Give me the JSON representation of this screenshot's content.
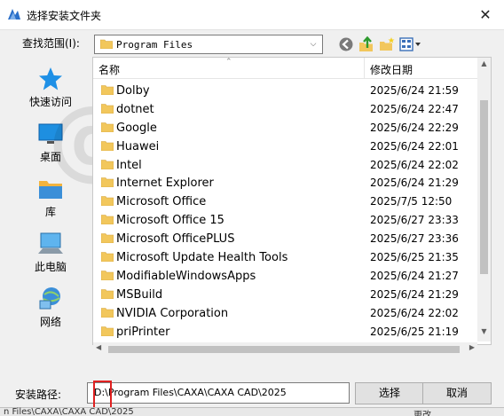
{
  "dialog": {
    "title": "选择安装文件夹",
    "close_glyph": "✕"
  },
  "look_in": {
    "label": "查找范围(I):",
    "value": "Program Files"
  },
  "places": [
    {
      "label": "快速访问",
      "icon": "star-icon"
    },
    {
      "label": "桌面",
      "icon": "desktop-icon"
    },
    {
      "label": "库",
      "icon": "library-icon"
    },
    {
      "label": "此电脑",
      "icon": "computer-icon"
    },
    {
      "label": "网络",
      "icon": "network-icon"
    }
  ],
  "columns": {
    "name": "名称",
    "date": "修改日期"
  },
  "files": [
    {
      "name": "Dolby",
      "date": "2025/6/24 21:59"
    },
    {
      "name": "dotnet",
      "date": "2025/6/24 22:47"
    },
    {
      "name": "Google",
      "date": "2025/6/24 22:29"
    },
    {
      "name": "Huawei",
      "date": "2025/6/24 22:01"
    },
    {
      "name": "Intel",
      "date": "2025/6/24 22:02"
    },
    {
      "name": "Internet Explorer",
      "date": "2025/6/24 21:29"
    },
    {
      "name": "Microsoft Office",
      "date": "2025/7/5 12:50"
    },
    {
      "name": "Microsoft Office 15",
      "date": "2025/6/27 23:33"
    },
    {
      "name": "Microsoft OfficePLUS",
      "date": "2025/6/27 23:36"
    },
    {
      "name": "Microsoft Update Health Tools",
      "date": "2025/6/25 21:35"
    },
    {
      "name": "ModifiableWindowsApps",
      "date": "2025/6/24 21:27"
    },
    {
      "name": "MSBuild",
      "date": "2025/6/24 21:29"
    },
    {
      "name": "NVIDIA Corporation",
      "date": "2025/6/24 22:02"
    },
    {
      "name": "priPrinter",
      "date": "2025/6/25 21:19"
    }
  ],
  "install_path": {
    "label": "安装路径:",
    "value": "D:\\Program Files\\CAXA\\CAXA CAD\\2025"
  },
  "buttons": {
    "select": "选择",
    "cancel": "取消"
  },
  "background": {
    "left_text": "n Files\\CAXA\\CAXA CAD\\2025",
    "right_text": "更改"
  },
  "watermark": "@源于风",
  "colors": {
    "folder": "#f2c75c",
    "accent": "#0078d7",
    "highlight_box": "#e02020"
  }
}
